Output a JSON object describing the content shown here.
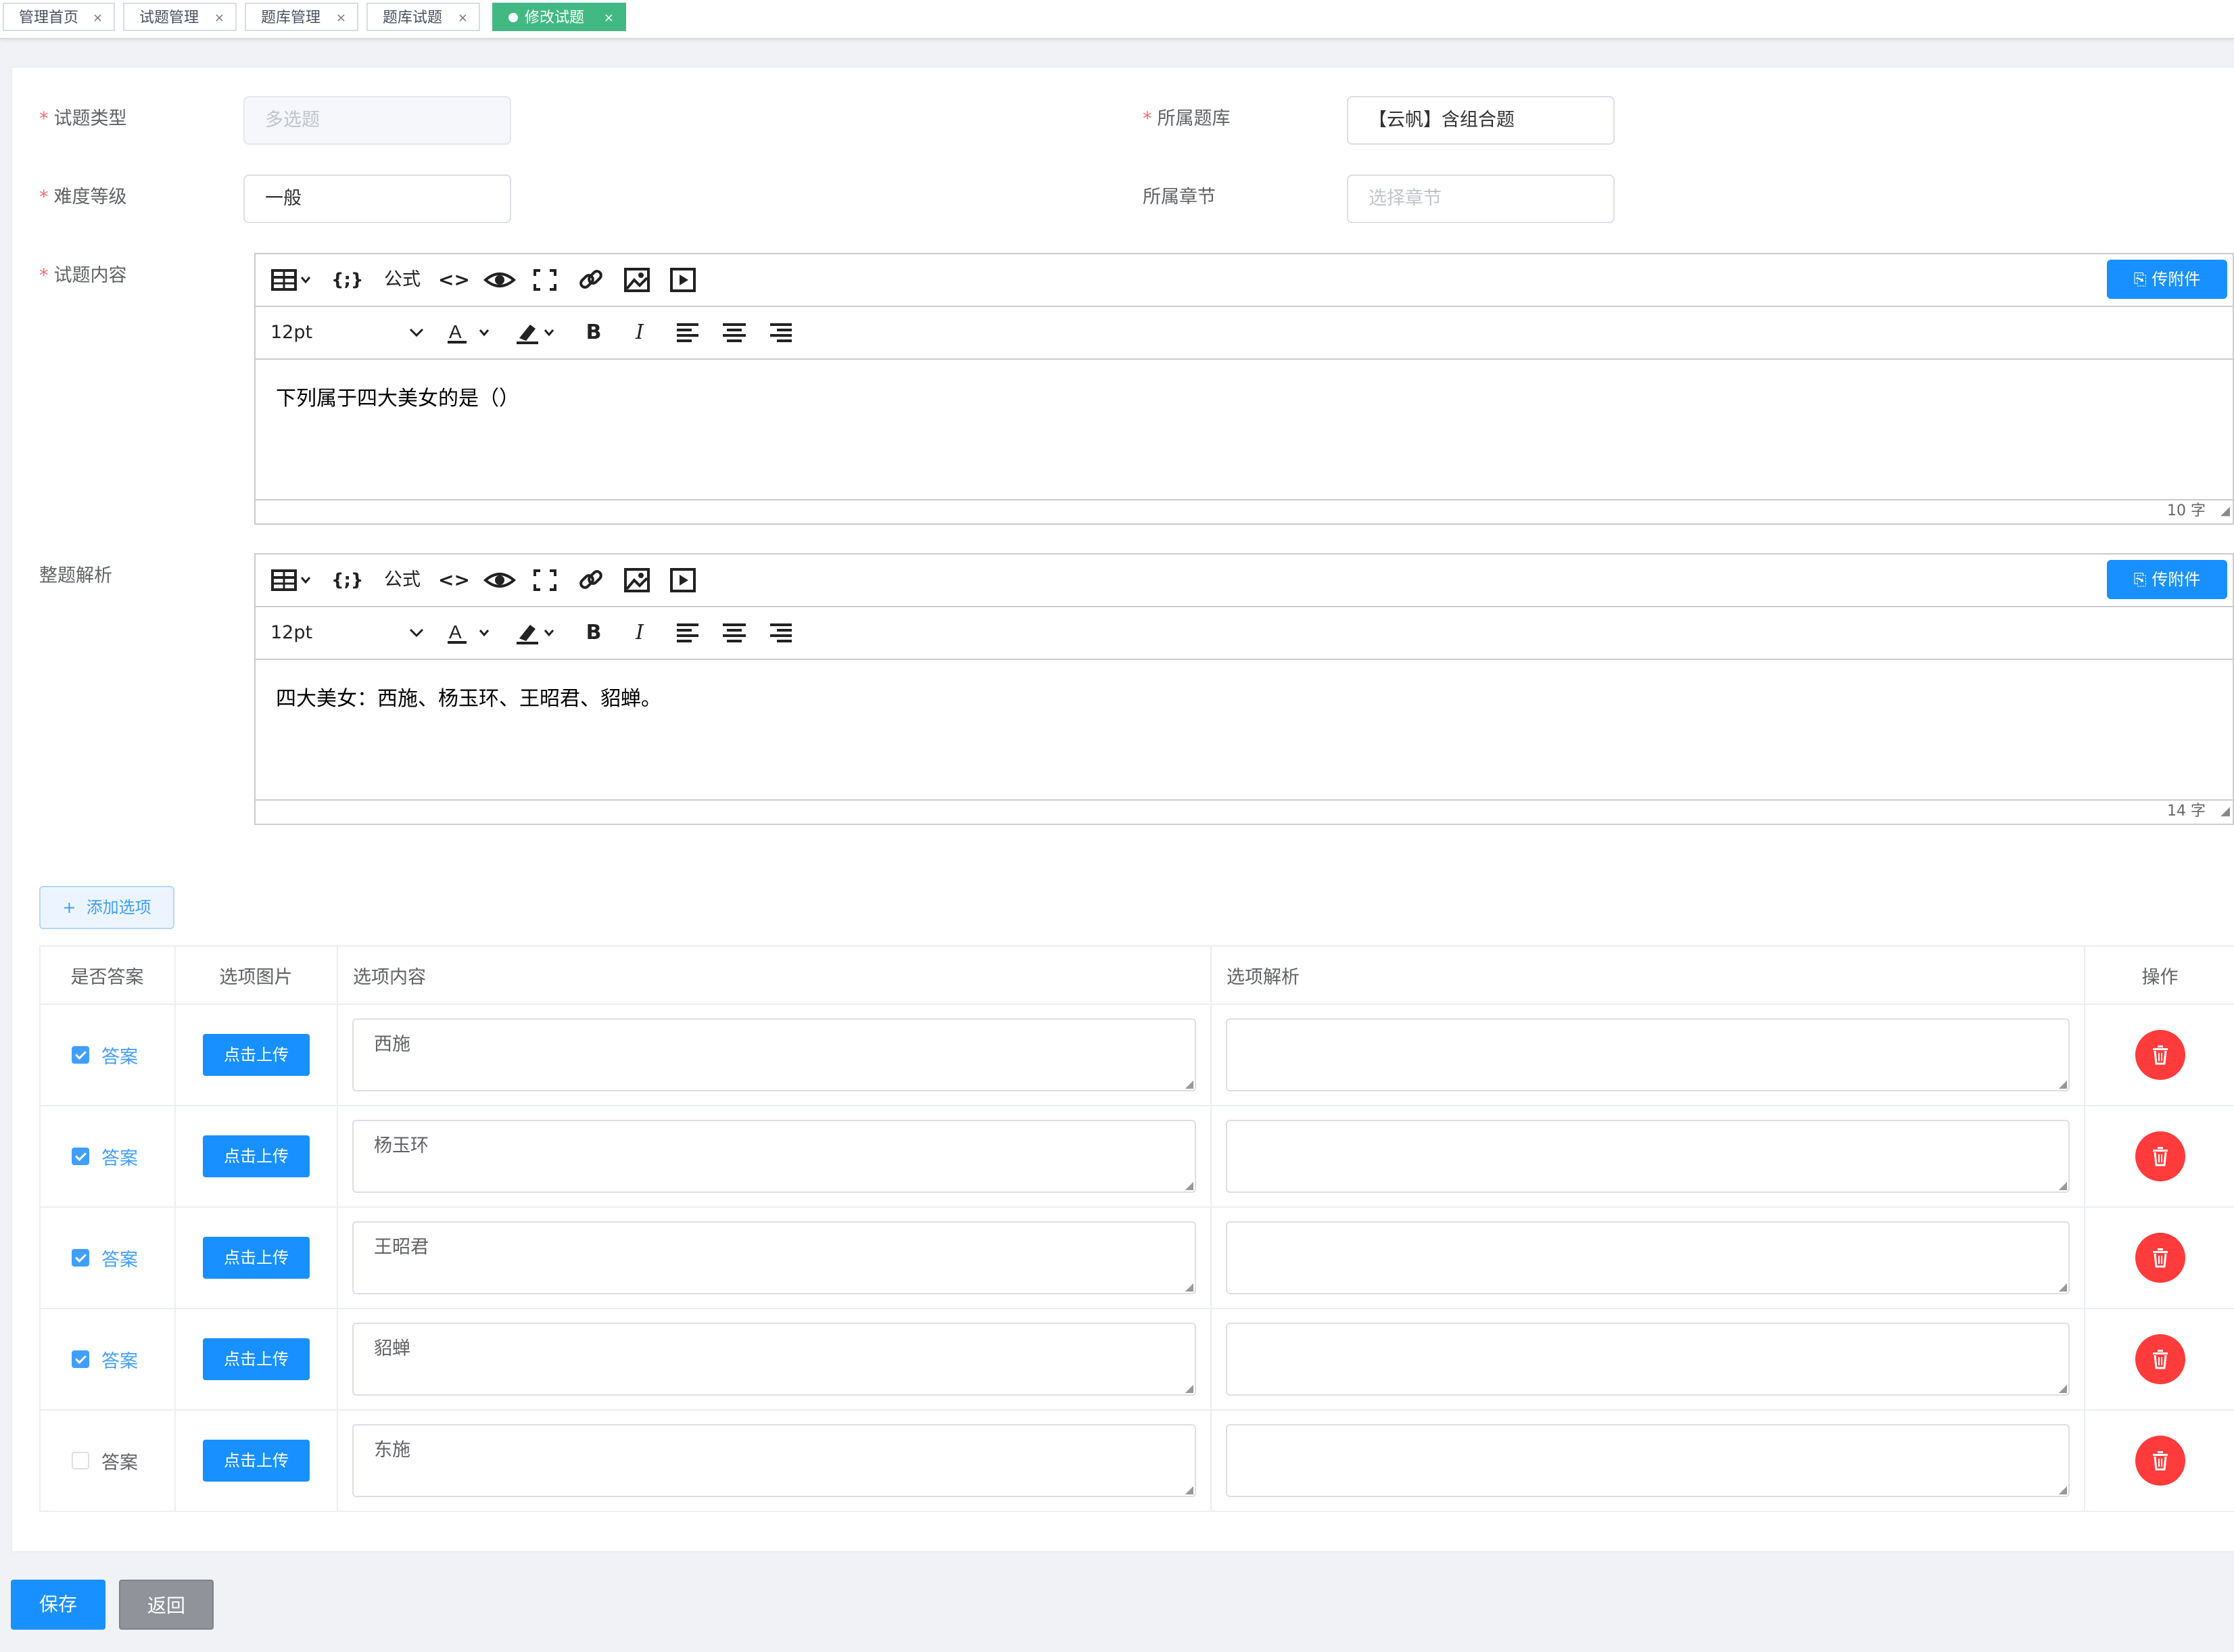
{
  "tabs": [
    {
      "label": "管理首页",
      "active": false
    },
    {
      "label": "试题管理",
      "active": false
    },
    {
      "label": "题库管理",
      "active": false
    },
    {
      "label": "题库试题",
      "active": false
    },
    {
      "label": "修改试题",
      "active": true
    }
  ],
  "tab_close_glyph": "×",
  "form": {
    "question_type": {
      "label": "试题类型",
      "value": "多选题",
      "required": true
    },
    "bank": {
      "label": "所属题库",
      "value": "【云帆】含组合题",
      "required": true
    },
    "difficulty": {
      "label": "难度等级",
      "value": "一般",
      "required": true
    },
    "chapter": {
      "label": "所属章节",
      "placeholder": "选择章节",
      "required": false
    },
    "content": {
      "label": "试题内容",
      "required": true
    },
    "analysis": {
      "label": "整题解析",
      "required": false
    }
  },
  "required_mark": "*",
  "editor_common": {
    "formula_label": "公式",
    "upload_label": "传附件",
    "font_size": "12pt"
  },
  "editors": {
    "content": {
      "text": "下列属于四大美女的是（）",
      "count": "10 字"
    },
    "analysis": {
      "text": "四大美女：西施、杨玉环、王昭君、貂蝉。",
      "count": "14 字"
    }
  },
  "add_option": {
    "icon": "+",
    "label": "添加选项"
  },
  "table": {
    "headers": [
      "是否答案",
      "选项图片",
      "选项内容",
      "选项解析",
      "操作"
    ],
    "upload_label": "点击上传",
    "answer_label": "答案",
    "rows": [
      {
        "checked": true,
        "content": "西施",
        "analysis": ""
      },
      {
        "checked": true,
        "content": "杨玉环",
        "analysis": ""
      },
      {
        "checked": true,
        "content": "王昭君",
        "analysis": ""
      },
      {
        "checked": true,
        "content": "貂蝉",
        "analysis": ""
      },
      {
        "checked": false,
        "content": "东施",
        "analysis": ""
      }
    ]
  },
  "buttons": {
    "save": "保存",
    "back": "返回"
  },
  "colors": {
    "primary": "#1890ff",
    "tab_active": "#42b983",
    "danger": "#ff3b3b",
    "required": "#f56c6c"
  },
  "icons": {
    "table": "table-icon",
    "code_block": "braces-icon",
    "code": "code-icon",
    "preview": "eye-icon",
    "fullscreen": "fullscreen-icon",
    "link": "link-icon",
    "image": "image-icon",
    "video": "video-icon",
    "delete": "trash-icon"
  }
}
